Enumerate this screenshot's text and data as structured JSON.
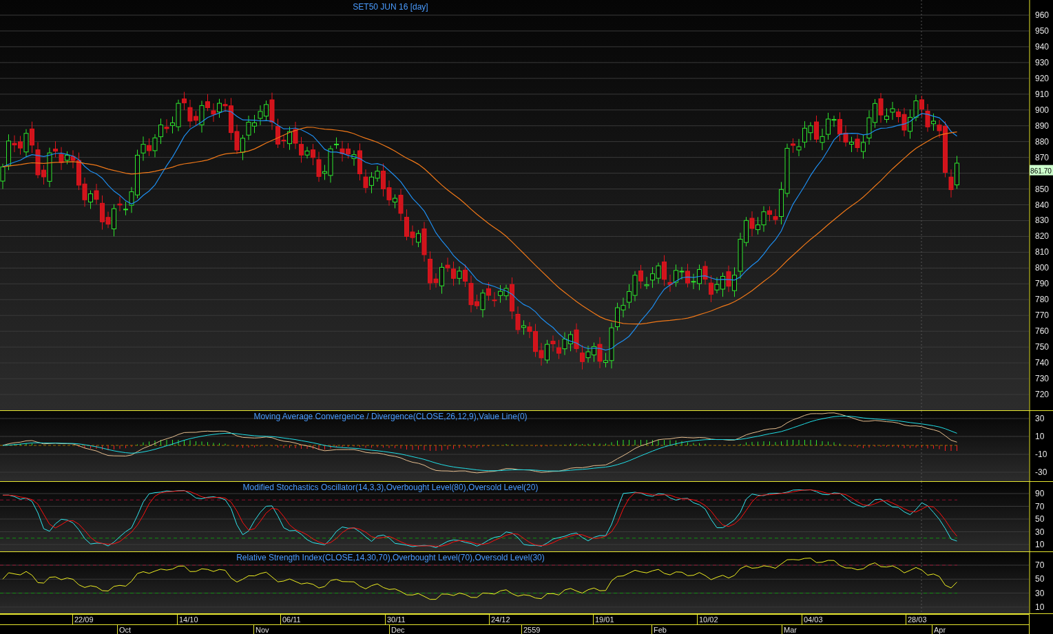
{
  "price_chart": {
    "title": "SET50 JUN 16  [day]",
    "y_ticks": [
      "960",
      "950",
      "940",
      "930",
      "920",
      "910",
      "900",
      "890",
      "880",
      "870",
      "850",
      "840",
      "830",
      "820",
      "810",
      "800",
      "790",
      "780",
      "770",
      "760",
      "750",
      "740",
      "730",
      "720"
    ],
    "last_price": "861.70"
  },
  "macd": {
    "title": "Moving Average Convergence / Divergence(CLOSE,26,12,9),Value Line(0)",
    "y_ticks": [
      "30",
      "10",
      "-10",
      "-30"
    ]
  },
  "stochastic": {
    "title": "Modified Stochastics Oscillator(14,3,3),Overbought Level(80),Oversold Level(20)",
    "y_ticks": [
      "90",
      "70",
      "50",
      "30",
      "10"
    ]
  },
  "rsi": {
    "title": "Relative Strength Index(CLOSE,14,30,70),Overbought Level(70),Oversold Level(30)",
    "y_ticks": [
      "70",
      "50",
      "30",
      "10"
    ]
  },
  "date_axis": {
    "dates": [
      "22/09",
      "14/10",
      "06/11",
      "30/11",
      "24/12",
      "19/01",
      "10/02",
      "04/03",
      "28/03"
    ],
    "months": [
      "Oct",
      "Nov",
      "Dec",
      "2559",
      "Feb",
      "Mar",
      "Apr"
    ]
  }
}
